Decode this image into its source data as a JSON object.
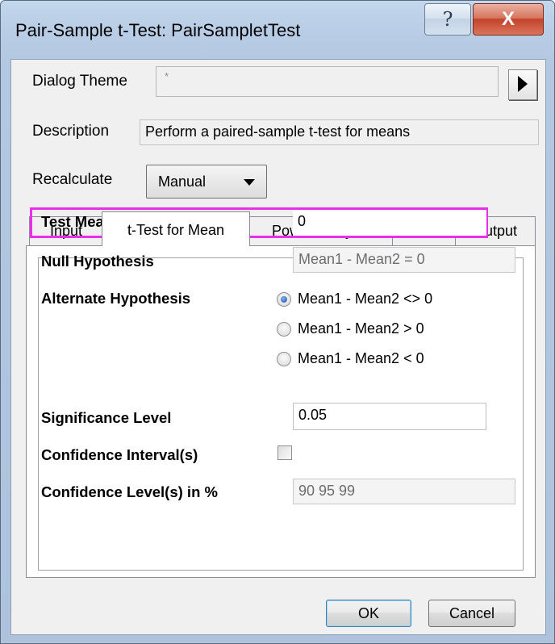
{
  "window": {
    "title": "Pair-Sample t-Test: PairSampletTest",
    "help_glyph": "?",
    "close_glyph": "X"
  },
  "dialog_theme": {
    "label": "Dialog Theme",
    "value": "*",
    "arrow_icon": "right-triangle-icon"
  },
  "description": {
    "label": "Description",
    "value": "Perform a paired-sample t-test for means"
  },
  "recalculate": {
    "label": "Recalculate",
    "selected": "Manual"
  },
  "tabs": [
    {
      "label": "Input"
    },
    {
      "label": "t-Test for Mean"
    },
    {
      "label": "Power Analysis"
    },
    {
      "label": "Plots"
    },
    {
      "label": "Output"
    }
  ],
  "active_tab": "t-Test for Mean",
  "form": {
    "test_mean": {
      "label": "Test Mean",
      "value": "0"
    },
    "null_hypothesis": {
      "label": "Null Hypothesis",
      "value": "Mean1 - Mean2 = 0"
    },
    "alternate_hypothesis": {
      "label": "Alternate Hypothesis",
      "options": [
        {
          "label": "Mean1 - Mean2 <> 0",
          "selected": true
        },
        {
          "label": "Mean1 - Mean2 > 0",
          "selected": false
        },
        {
          "label": "Mean1 - Mean2 < 0",
          "selected": false
        }
      ]
    },
    "significance_level": {
      "label": "Significance Level",
      "value": "0.05"
    },
    "confidence_intervals": {
      "label": "Confidence Interval(s)",
      "checked": false
    },
    "confidence_levels": {
      "label": "Confidence Level(s) in %",
      "value": "90 95 99"
    }
  },
  "buttons": {
    "ok": "OK",
    "cancel": "Cancel"
  },
  "colors": {
    "highlight": "#e830e8",
    "close_button": "#c4432b"
  }
}
